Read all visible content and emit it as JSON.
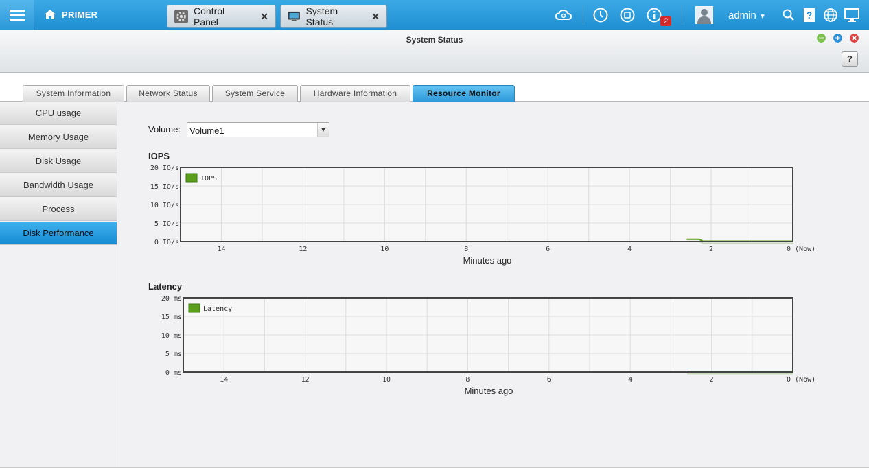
{
  "topbar": {
    "home_label": "PRIMER",
    "tabs": [
      {
        "label": "Control Panel"
      },
      {
        "label": "System Status"
      }
    ],
    "notification_count": "2",
    "user": "admin"
  },
  "window": {
    "title": "System Status",
    "help": "?"
  },
  "section_tabs": [
    {
      "label": "System Information"
    },
    {
      "label": "Network Status"
    },
    {
      "label": "System Service"
    },
    {
      "label": "Hardware Information"
    },
    {
      "label": "Resource Monitor",
      "active": true
    }
  ],
  "sidenav": [
    {
      "label": "CPU usage"
    },
    {
      "label": "Memory Usage"
    },
    {
      "label": "Disk Usage"
    },
    {
      "label": "Bandwidth Usage"
    },
    {
      "label": "Process"
    },
    {
      "label": "Disk Performance",
      "active": true
    }
  ],
  "volume": {
    "label": "Volume:",
    "value": "Volume1"
  },
  "colors": {
    "accent": "#2c9ad9",
    "series": "#5a9e1a"
  },
  "chart_data": [
    {
      "type": "line",
      "title": "IOPS",
      "xlabel": "Minutes ago",
      "x_ticks": [
        "14",
        "12",
        "10",
        "8",
        "6",
        "4",
        "2",
        "0 (Now)"
      ],
      "y_ticks": [
        "20 IO/s",
        "15 IO/s",
        "10 IO/s",
        "5 IO/s",
        "0 IO/s"
      ],
      "ylim": [
        0,
        20
      ],
      "xlim": [
        15,
        0
      ],
      "grid": true,
      "legend": "top-left",
      "series": [
        {
          "name": "IOPS",
          "x": [
            2.6,
            2.3,
            2.2,
            0
          ],
          "y": [
            0.6,
            0.6,
            0.1,
            0.1
          ]
        }
      ]
    },
    {
      "type": "line",
      "title": "Latency",
      "xlabel": "Minutes ago",
      "x_ticks": [
        "14",
        "12",
        "10",
        "8",
        "6",
        "4",
        "2",
        "0 (Now)"
      ],
      "y_ticks": [
        "20 ms",
        "15 ms",
        "10 ms",
        "5 ms",
        "0 ms"
      ],
      "ylim": [
        0,
        20
      ],
      "xlim": [
        15,
        0
      ],
      "grid": true,
      "legend": "top-left",
      "series": [
        {
          "name": "Latency",
          "x": [
            2.6,
            0
          ],
          "y": [
            0.1,
            0.1
          ]
        }
      ]
    }
  ]
}
